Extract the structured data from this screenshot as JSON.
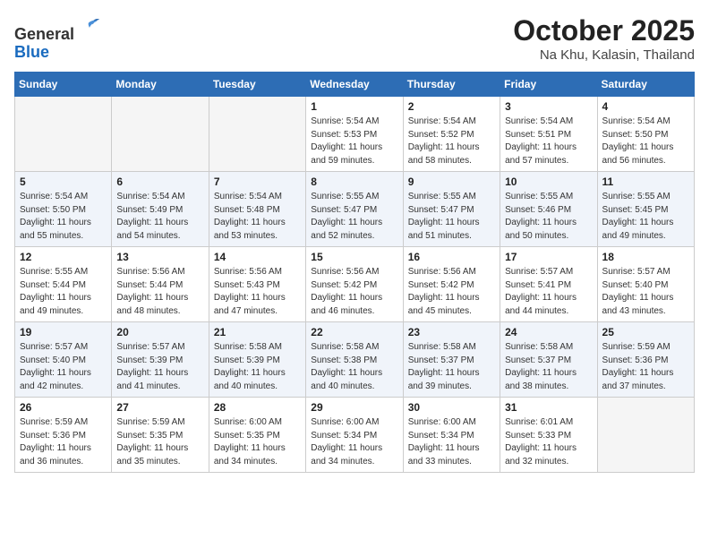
{
  "header": {
    "logo_line1": "General",
    "logo_line2": "Blue",
    "month": "October 2025",
    "location": "Na Khu, Kalasin, Thailand"
  },
  "weekdays": [
    "Sunday",
    "Monday",
    "Tuesday",
    "Wednesday",
    "Thursday",
    "Friday",
    "Saturday"
  ],
  "weeks": [
    [
      {
        "day": "",
        "sunrise": "",
        "sunset": "",
        "daylight": ""
      },
      {
        "day": "",
        "sunrise": "",
        "sunset": "",
        "daylight": ""
      },
      {
        "day": "",
        "sunrise": "",
        "sunset": "",
        "daylight": ""
      },
      {
        "day": "1",
        "sunrise": "Sunrise: 5:54 AM",
        "sunset": "Sunset: 5:53 PM",
        "daylight": "Daylight: 11 hours and 59 minutes."
      },
      {
        "day": "2",
        "sunrise": "Sunrise: 5:54 AM",
        "sunset": "Sunset: 5:52 PM",
        "daylight": "Daylight: 11 hours and 58 minutes."
      },
      {
        "day": "3",
        "sunrise": "Sunrise: 5:54 AM",
        "sunset": "Sunset: 5:51 PM",
        "daylight": "Daylight: 11 hours and 57 minutes."
      },
      {
        "day": "4",
        "sunrise": "Sunrise: 5:54 AM",
        "sunset": "Sunset: 5:50 PM",
        "daylight": "Daylight: 11 hours and 56 minutes."
      }
    ],
    [
      {
        "day": "5",
        "sunrise": "Sunrise: 5:54 AM",
        "sunset": "Sunset: 5:50 PM",
        "daylight": "Daylight: 11 hours and 55 minutes."
      },
      {
        "day": "6",
        "sunrise": "Sunrise: 5:54 AM",
        "sunset": "Sunset: 5:49 PM",
        "daylight": "Daylight: 11 hours and 54 minutes."
      },
      {
        "day": "7",
        "sunrise": "Sunrise: 5:54 AM",
        "sunset": "Sunset: 5:48 PM",
        "daylight": "Daylight: 11 hours and 53 minutes."
      },
      {
        "day": "8",
        "sunrise": "Sunrise: 5:55 AM",
        "sunset": "Sunset: 5:47 PM",
        "daylight": "Daylight: 11 hours and 52 minutes."
      },
      {
        "day": "9",
        "sunrise": "Sunrise: 5:55 AM",
        "sunset": "Sunset: 5:47 PM",
        "daylight": "Daylight: 11 hours and 51 minutes."
      },
      {
        "day": "10",
        "sunrise": "Sunrise: 5:55 AM",
        "sunset": "Sunset: 5:46 PM",
        "daylight": "Daylight: 11 hours and 50 minutes."
      },
      {
        "day": "11",
        "sunrise": "Sunrise: 5:55 AM",
        "sunset": "Sunset: 5:45 PM",
        "daylight": "Daylight: 11 hours and 49 minutes."
      }
    ],
    [
      {
        "day": "12",
        "sunrise": "Sunrise: 5:55 AM",
        "sunset": "Sunset: 5:44 PM",
        "daylight": "Daylight: 11 hours and 49 minutes."
      },
      {
        "day": "13",
        "sunrise": "Sunrise: 5:56 AM",
        "sunset": "Sunset: 5:44 PM",
        "daylight": "Daylight: 11 hours and 48 minutes."
      },
      {
        "day": "14",
        "sunrise": "Sunrise: 5:56 AM",
        "sunset": "Sunset: 5:43 PM",
        "daylight": "Daylight: 11 hours and 47 minutes."
      },
      {
        "day": "15",
        "sunrise": "Sunrise: 5:56 AM",
        "sunset": "Sunset: 5:42 PM",
        "daylight": "Daylight: 11 hours and 46 minutes."
      },
      {
        "day": "16",
        "sunrise": "Sunrise: 5:56 AM",
        "sunset": "Sunset: 5:42 PM",
        "daylight": "Daylight: 11 hours and 45 minutes."
      },
      {
        "day": "17",
        "sunrise": "Sunrise: 5:57 AM",
        "sunset": "Sunset: 5:41 PM",
        "daylight": "Daylight: 11 hours and 44 minutes."
      },
      {
        "day": "18",
        "sunrise": "Sunrise: 5:57 AM",
        "sunset": "Sunset: 5:40 PM",
        "daylight": "Daylight: 11 hours and 43 minutes."
      }
    ],
    [
      {
        "day": "19",
        "sunrise": "Sunrise: 5:57 AM",
        "sunset": "Sunset: 5:40 PM",
        "daylight": "Daylight: 11 hours and 42 minutes."
      },
      {
        "day": "20",
        "sunrise": "Sunrise: 5:57 AM",
        "sunset": "Sunset: 5:39 PM",
        "daylight": "Daylight: 11 hours and 41 minutes."
      },
      {
        "day": "21",
        "sunrise": "Sunrise: 5:58 AM",
        "sunset": "Sunset: 5:39 PM",
        "daylight": "Daylight: 11 hours and 40 minutes."
      },
      {
        "day": "22",
        "sunrise": "Sunrise: 5:58 AM",
        "sunset": "Sunset: 5:38 PM",
        "daylight": "Daylight: 11 hours and 40 minutes."
      },
      {
        "day": "23",
        "sunrise": "Sunrise: 5:58 AM",
        "sunset": "Sunset: 5:37 PM",
        "daylight": "Daylight: 11 hours and 39 minutes."
      },
      {
        "day": "24",
        "sunrise": "Sunrise: 5:58 AM",
        "sunset": "Sunset: 5:37 PM",
        "daylight": "Daylight: 11 hours and 38 minutes."
      },
      {
        "day": "25",
        "sunrise": "Sunrise: 5:59 AM",
        "sunset": "Sunset: 5:36 PM",
        "daylight": "Daylight: 11 hours and 37 minutes."
      }
    ],
    [
      {
        "day": "26",
        "sunrise": "Sunrise: 5:59 AM",
        "sunset": "Sunset: 5:36 PM",
        "daylight": "Daylight: 11 hours and 36 minutes."
      },
      {
        "day": "27",
        "sunrise": "Sunrise: 5:59 AM",
        "sunset": "Sunset: 5:35 PM",
        "daylight": "Daylight: 11 hours and 35 minutes."
      },
      {
        "day": "28",
        "sunrise": "Sunrise: 6:00 AM",
        "sunset": "Sunset: 5:35 PM",
        "daylight": "Daylight: 11 hours and 34 minutes."
      },
      {
        "day": "29",
        "sunrise": "Sunrise: 6:00 AM",
        "sunset": "Sunset: 5:34 PM",
        "daylight": "Daylight: 11 hours and 34 minutes."
      },
      {
        "day": "30",
        "sunrise": "Sunrise: 6:00 AM",
        "sunset": "Sunset: 5:34 PM",
        "daylight": "Daylight: 11 hours and 33 minutes."
      },
      {
        "day": "31",
        "sunrise": "Sunrise: 6:01 AM",
        "sunset": "Sunset: 5:33 PM",
        "daylight": "Daylight: 11 hours and 32 minutes."
      },
      {
        "day": "",
        "sunrise": "",
        "sunset": "",
        "daylight": ""
      }
    ]
  ]
}
